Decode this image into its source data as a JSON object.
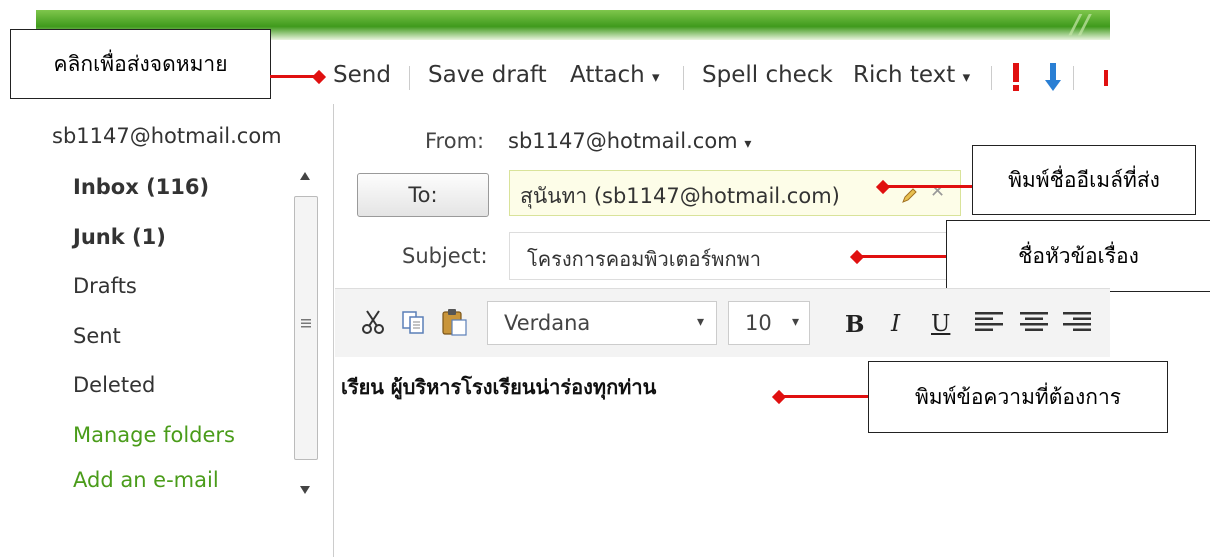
{
  "toolbar": {
    "send": "Send",
    "save_draft": "Save draft",
    "attach": "Attach",
    "spell_check": "Spell check",
    "rich_text": "Rich text",
    "dropdown_glyph": "▾"
  },
  "callouts": {
    "send": "คลิกเพื่อส่งจดหมาย",
    "to": "พิมพ์ชื่ออีเมล์ที่ส่ง",
    "subject": "ชื่อหัวข้อเรื่อง",
    "body": "พิมพ์ข้อความที่ต้องการ"
  },
  "sidebar": {
    "account": "sb1147@hotmail.com",
    "folders": [
      {
        "label": "Inbox (116)",
        "style": "bold"
      },
      {
        "label": "Junk (1)",
        "style": "bold"
      },
      {
        "label": "Drafts",
        "style": "normal"
      },
      {
        "label": "Sent",
        "style": "normal"
      },
      {
        "label": "Deleted",
        "style": "normal"
      },
      {
        "label": "Manage folders",
        "style": "link"
      },
      {
        "label": "Add an e-mail",
        "style": "link"
      }
    ]
  },
  "compose": {
    "from_label": "From:",
    "from_value": "sb1147@hotmail.com",
    "to_button": "To:",
    "to_value": "สุนันทา  (sb1147@hotmail.com)",
    "subject_label": "Subject:",
    "subject_value": "โครงการคอมพิวเตอร์พกพา",
    "body_text": "เรียน   ผู้บริหารโรงเรียนน่าร่องทุกท่าน"
  },
  "format": {
    "font_name": "Verdana",
    "font_size": "10",
    "bold": "B",
    "italic": "I",
    "underline": "U"
  },
  "colors": {
    "accent_green": "#4a9c1a",
    "callout_red": "#e01010",
    "importance_red": "#e01010",
    "importance_blue": "#2a7fd4"
  },
  "icons": [
    "pencil-icon",
    "remove-icon",
    "cut-icon",
    "copy-icon",
    "paste-icon",
    "align-left-icon",
    "align-center-icon",
    "align-right-icon",
    "high-importance-icon",
    "low-importance-icon"
  ]
}
